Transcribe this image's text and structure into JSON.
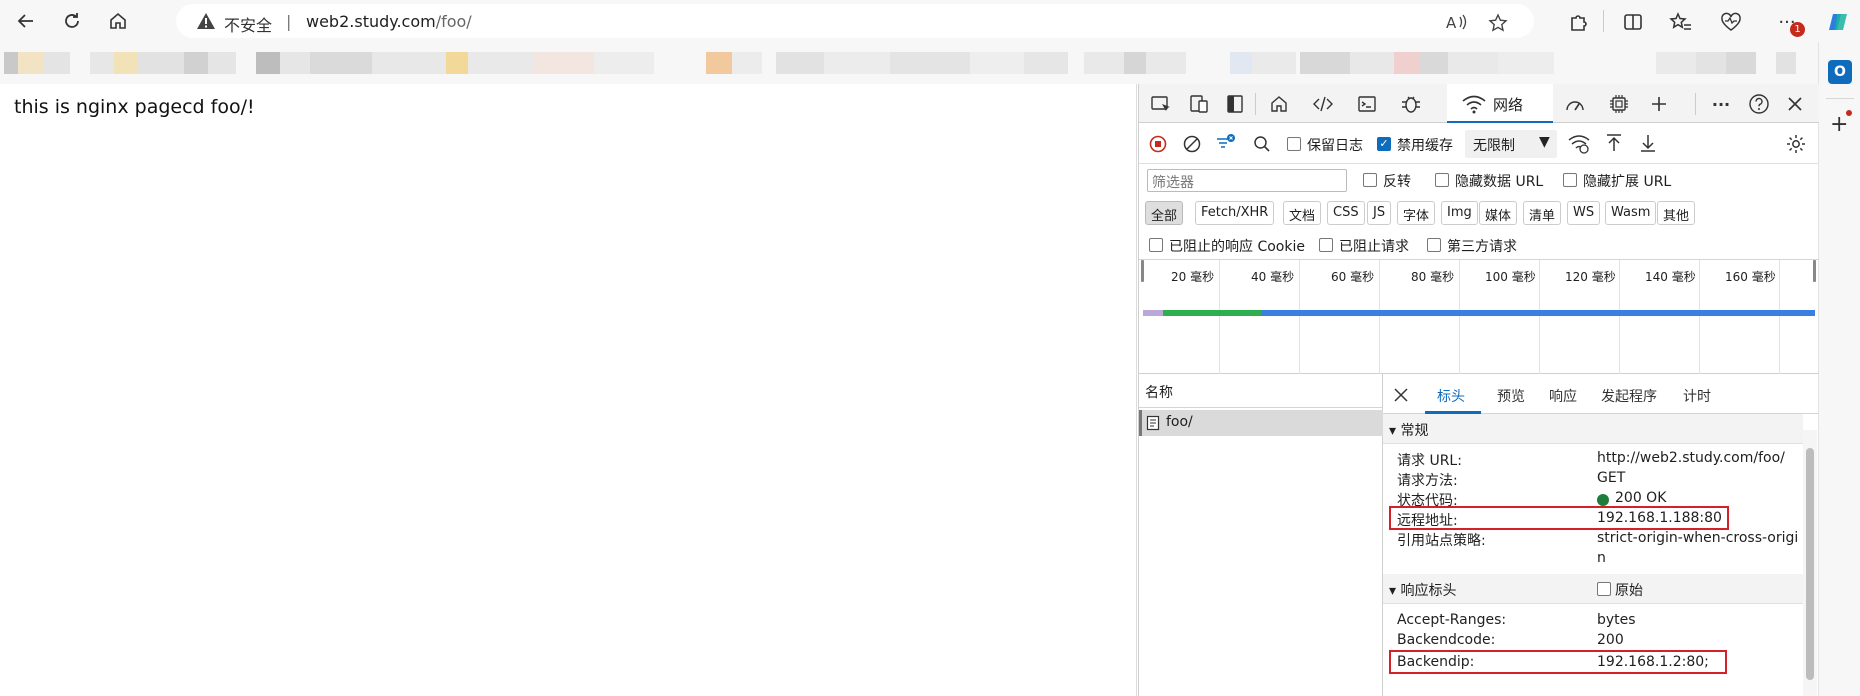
{
  "browser": {
    "security_label": "不安全",
    "separator": "|",
    "url_host": "web2.study.com",
    "url_path": "/foo/",
    "notification_count": "1"
  },
  "page": {
    "body_text": "this is nginx pagecd foo/!"
  },
  "devtools": {
    "active_tab": "网络",
    "toolbar": {
      "preserve_log": "保留日志",
      "disable_cache": "禁用缓存",
      "throttle": "无限制"
    },
    "filter": {
      "placeholder": "筛选器",
      "invert": "反转",
      "hide_data_urls": "隐藏数据 URL",
      "hide_extension_urls": "隐藏扩展 URL"
    },
    "types": [
      "全部",
      "Fetch/XHR",
      "文档",
      "CSS",
      "JS",
      "字体",
      "Img",
      "媒体",
      "清单",
      "WS",
      "Wasm",
      "其他"
    ],
    "cookie_row": {
      "blocked_cookies": "已阻止的响应 Cookie",
      "blocked_requests": "已阻止请求",
      "third_party": "第三方请求"
    },
    "timeline_ticks": [
      "20 毫秒",
      "40 毫秒",
      "60 毫秒",
      "80 毫秒",
      "100 毫秒",
      "120 毫秒",
      "140 毫秒",
      "160 毫秒"
    ],
    "name_header": "名称",
    "request_name": "foo/",
    "detail_tabs": [
      "标头",
      "预览",
      "响应",
      "发起程序",
      "计时"
    ],
    "general": {
      "title": "▾ 常规",
      "rows": [
        {
          "k": "请求 URL:",
          "v": "http://web2.study.com/foo/"
        },
        {
          "k": "请求方法:",
          "v": "GET"
        },
        {
          "k": "状态代码:",
          "v": "200 OK"
        },
        {
          "k": "远程地址:",
          "v": "192.168.1.188:80"
        },
        {
          "k": "引用站点策略:",
          "v": "strict-origin-when-cross-origi"
        },
        {
          "k": "",
          "v": "n"
        }
      ]
    },
    "response_headers": {
      "title": "▾ 响应标头",
      "raw_label": "原始",
      "rows": [
        {
          "k": "Accept-Ranges:",
          "v": "bytes"
        },
        {
          "k": "Backendcode:",
          "v": "200"
        },
        {
          "k": "Backendip:",
          "v": "192.168.1.2:80;"
        }
      ]
    },
    "colors": {
      "accent": "#0f6cbd",
      "highlight": "#d4202a",
      "status_ok": "#1e7d3a",
      "timeline_green": "#2fae4f",
      "timeline_blue": "#3b7fe0"
    }
  }
}
